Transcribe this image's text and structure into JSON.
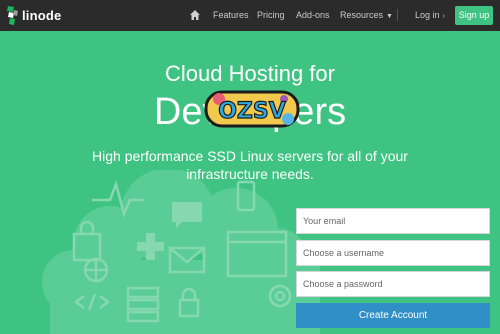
{
  "brand": {
    "name": "linode"
  },
  "nav": {
    "home_icon": "home-icon",
    "links": [
      {
        "label": "Features"
      },
      {
        "label": "Pricing"
      },
      {
        "label": "Add-ons"
      },
      {
        "label": "Resources"
      }
    ],
    "login_label": "Log in",
    "signup_label": "Sign up"
  },
  "hero": {
    "title_line1": "Cloud Hosting for",
    "title_line2": "Developers",
    "sticker_text": "OZSV",
    "subtitle": "High performance SSD Linux servers for all of your infrastructure needs."
  },
  "signup_form": {
    "email_placeholder": "Your email",
    "username_placeholder": "Choose a username",
    "password_placeholder": "Choose a password",
    "submit_label": "Create Account"
  },
  "colors": {
    "hero_background": "#3fc383",
    "navbar_background": "#2b2b2b",
    "primary_button": "#2f8fc6",
    "signup_button": "#3fc383"
  }
}
